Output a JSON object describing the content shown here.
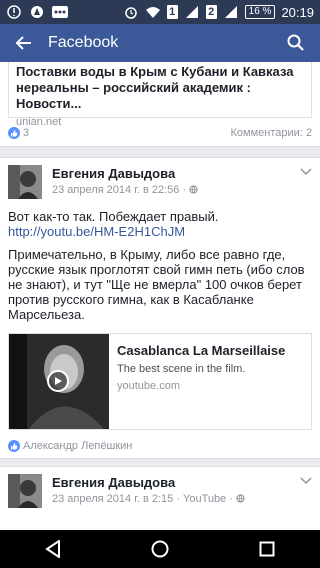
{
  "status_bar": {
    "sim1": "1",
    "sim2": "2",
    "battery": "16 %",
    "time": "20:19"
  },
  "app_bar": {
    "title": "Facebook",
    "back_icon": "arrow-left-icon",
    "search_icon": "search-icon"
  },
  "post_prev": {
    "link_title": "Поставки воды в Крым с Кубани и Кавказа нереальны – российский академик : Новости...",
    "link_domain": "unian.net",
    "likes": "3",
    "comments": "Комментарии: 2"
  },
  "post_main": {
    "author": "Евгения Давыдова",
    "meta": "23 апреля 2014 г. в 22:56 · ",
    "text1": "Вот как-то так. Побеждает правый.",
    "url": "http://youtu.be/HM-E2H1ChJM",
    "text2": "Примечательно, в Крыму, либо все равно где, русские язык проглотят свой гимн петь (ибо слов не знают), и тут \"Ще не вмерла\" 100 очков берет против русского гимна, как в Касабланке Марсельеза.",
    "preview": {
      "title": "Casablanca La Marseillaise",
      "description": "The best scene in the film.",
      "domain": "youtube.com"
    },
    "liked_by": "Александр Лепёшкин"
  },
  "post_next": {
    "author": "Евгения Давыдова",
    "meta": "23 апреля 2014 г. в 2:15 · YouTube · "
  },
  "colors": {
    "brand": "#3b5998",
    "status_bar": "#2d3a56",
    "link": "#365899",
    "like": "#5890ff"
  }
}
